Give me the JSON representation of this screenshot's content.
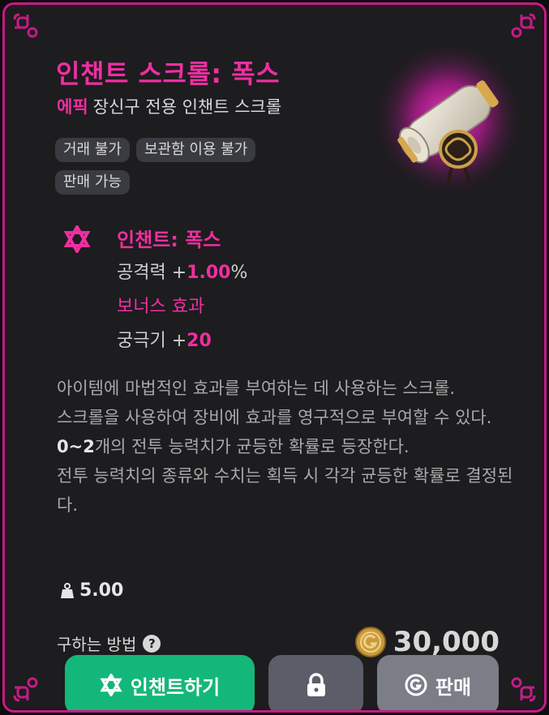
{
  "item": {
    "name": "인챈트 스크롤: 폭스",
    "grade": "에픽",
    "type": "장신구 전용 인챈트 스크롤",
    "tags": [
      "거래 불가",
      "보관함 이용 불가",
      "판매 가능"
    ],
    "image_icon": "scroll-with-medallion-icon"
  },
  "enchant": {
    "icon": "star-of-david-icon",
    "title": "인챈트: 폭스",
    "stat_name": "공격력 +",
    "stat_value": "1.00",
    "stat_unit": "%",
    "bonus_label": "보너스 효과",
    "bonus_name": "궁극기 +",
    "bonus_value": "20"
  },
  "description": {
    "line1": "아이템에 마법적인 효과를 부여하는 데 사용하는 스크롤.",
    "line2": "스크롤을 사용하여 장비에 효과를 영구적으로 부여할 수 있다.",
    "line3_highlight": "0~2",
    "line3_rest": "개의 전투 능력치가 균등한 확률로 등장한다.",
    "line4": "전투 능력치의 종류와 수치는 획득 시 각각 균등한 확률로 결정된다."
  },
  "weight": {
    "icon": "weight-icon",
    "value": "5.00"
  },
  "acquire": {
    "label": "구하는 방법",
    "help_icon": "question-mark-icon"
  },
  "price": {
    "icon": "gold-coin-icon",
    "value": "30,000"
  },
  "buttons": {
    "enchant_label": "인챈트하기",
    "enchant_icon": "star-of-david-icon",
    "lock_icon": "lock-icon",
    "sell_label": "판매",
    "sell_icon": "coin-g-icon"
  },
  "colors": {
    "accent": "#ee2fa0",
    "border": "#c41c86",
    "panel": "#1d1c1f",
    "enchant_button": "#14b77a",
    "lock_button": "#5b5d68",
    "sell_button": "#7b7d87"
  }
}
